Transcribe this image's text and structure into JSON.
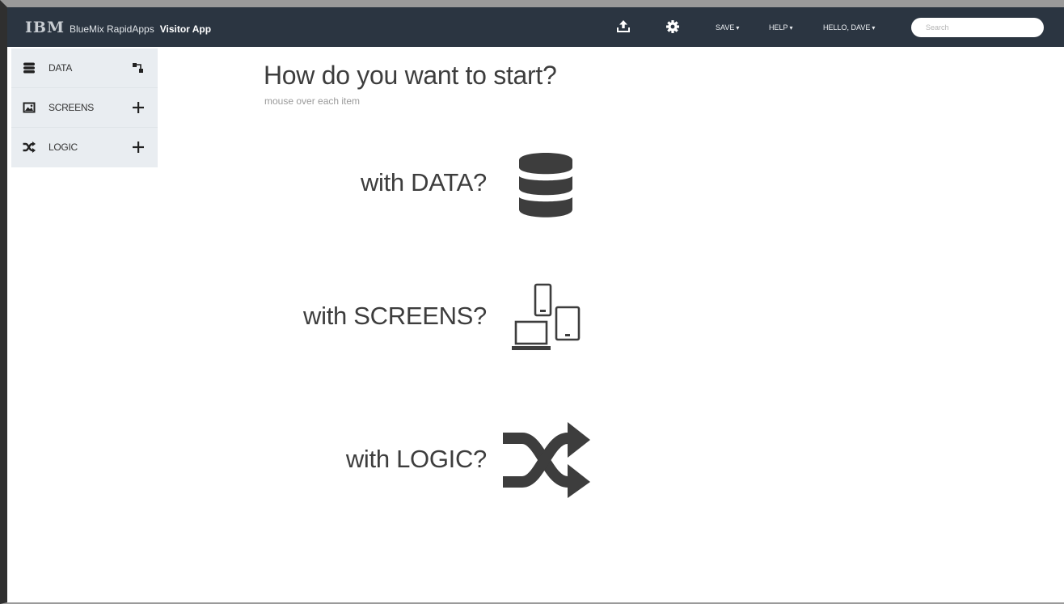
{
  "topbar": {
    "logo": "IBM",
    "product": "BlueMix RapidApps",
    "app_name": "Visitor App",
    "icons": [
      "upload-icon",
      "gear-icon"
    ],
    "menus": [
      {
        "label": "SAVE",
        "caret": "▾"
      },
      {
        "label": "HELP",
        "caret": "▾"
      },
      {
        "label": "HELLO, DAVE",
        "caret": "▾"
      }
    ],
    "search": {
      "placeholder": "Search",
      "value": ""
    }
  },
  "sidebar": {
    "items": [
      {
        "label": "DATA",
        "icon": "database-icon",
        "action": "connect-icon"
      },
      {
        "label": "SCREENS",
        "icon": "image-icon",
        "action": "plus-icon"
      },
      {
        "label": "LOGIC",
        "icon": "shuffle-icon",
        "action": "plus-icon"
      }
    ]
  },
  "main": {
    "heading": "How do you want to start?",
    "subheading": "mouse over each item",
    "options": [
      {
        "label": "with DATA?",
        "icon": "database-icon"
      },
      {
        "label": "with SCREENS?",
        "icon": "devices-icon"
      },
      {
        "label": "with LOGIC?",
        "icon": "shuffle-icon"
      }
    ]
  },
  "colors": {
    "topbar_bg": "#2b3541",
    "sidebar_bg": "#e9edf1",
    "icon_dark": "#3d3d3d"
  }
}
